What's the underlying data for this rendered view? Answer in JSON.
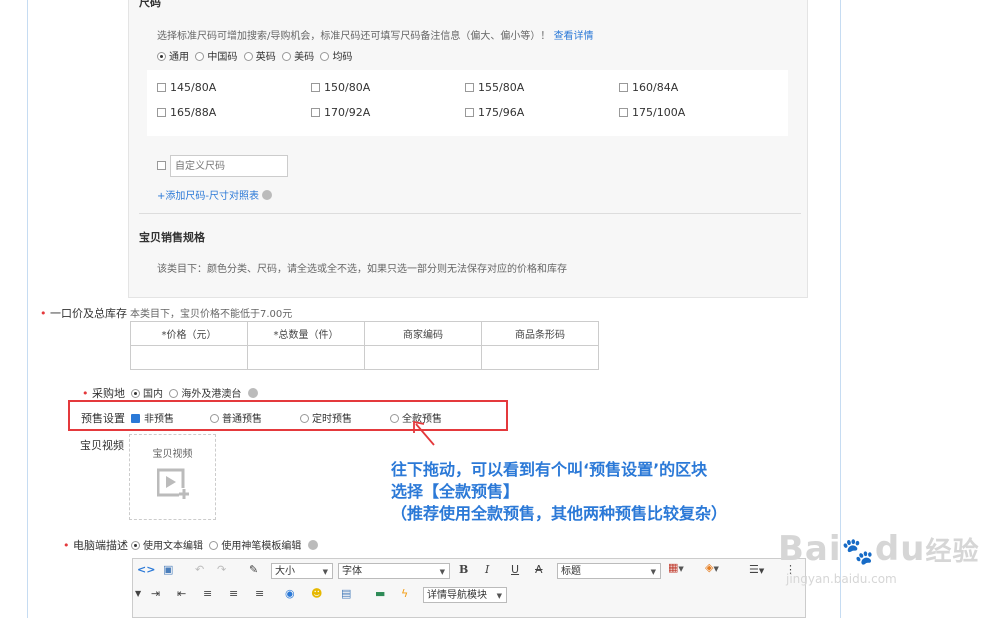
{
  "size_section": {
    "title": "尺码",
    "hint": "选择标准尺码可增加搜索/导购机会，标准尺码还可填写尺码备注信息（偏大、偏小等）！",
    "hint_link": "查看详情",
    "types": [
      "通用",
      "中国码",
      "英码",
      "美码",
      "均码"
    ],
    "sizes": [
      "145/80A",
      "150/80A",
      "155/80A",
      "160/84A",
      "165/88A",
      "170/92A",
      "175/96A",
      "175/100A"
    ],
    "custom_placeholder": "自定义尺码",
    "add_link": "+添加尺码-尺寸对照表"
  },
  "spec_section": {
    "title": "宝贝销售规格",
    "hint": "该类目下：颜色分类、尺码，请全选或全不选，如果只选一部分则无法保存对应的价格和库存"
  },
  "price_row": {
    "label": "一口价及总库存",
    "hint": "本类目下，宝贝价格不能低于7.00元",
    "headers": [
      "*价格（元）",
      "*总数量（件）",
      "商家编码",
      "商品条形码"
    ]
  },
  "origin_row": {
    "label": "采购地",
    "options": [
      "国内",
      "海外及港澳台"
    ]
  },
  "presale_row": {
    "label": "预售设置",
    "options": [
      "非预售",
      "普通预售",
      "定时预售",
      "全款预售"
    ]
  },
  "video_row": {
    "label": "宝贝视频",
    "box_title": "宝贝视频"
  },
  "desc_row": {
    "label": "电脑端描述",
    "options": [
      "使用文本编辑",
      "使用神笔模板编辑"
    ]
  },
  "editor": {
    "font_size": "大小",
    "font_family": "字体",
    "heading": "标题",
    "nav_module": "详情导航模块"
  },
  "annotation": {
    "line1": "往下拖动，可以看到有个叫‘预售设置’的区块",
    "line2": "选择【全款预售】",
    "line3": "（推荐使用全款预售，其他两种预售比较复杂）",
    "color": "#2b79d7"
  },
  "watermark": {
    "brand": "Bai",
    "brand2": "du",
    "cn": "经验",
    "url": "jingyan.baidu.com"
  },
  "colors": {
    "accent": "#2b79d7",
    "highlight": "#e4393c"
  }
}
